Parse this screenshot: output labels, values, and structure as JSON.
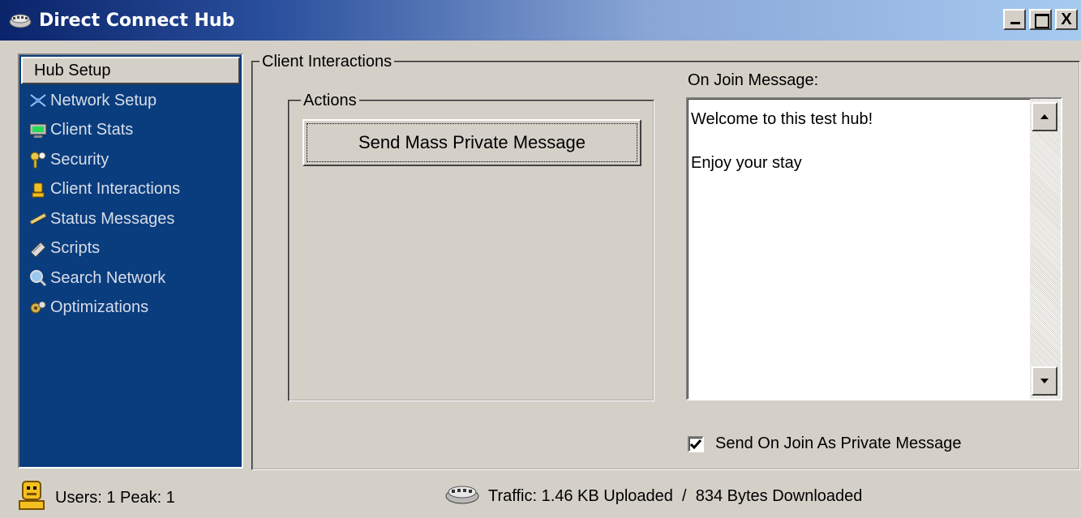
{
  "window": {
    "title": "Direct Connect Hub",
    "icon": "hub-icon",
    "buttons": {
      "minimize": "_",
      "maximize": "□",
      "close": "X"
    }
  },
  "sidebar": {
    "header": "Hub Setup",
    "items": [
      {
        "label": "Network Setup",
        "icon": "network-icon"
      },
      {
        "label": "Client Stats",
        "icon": "monitor-icon"
      },
      {
        "label": "Security",
        "icon": "keys-icon"
      },
      {
        "label": "Client Interactions",
        "icon": "user-icon"
      },
      {
        "label": "Status Messages",
        "icon": "messages-icon"
      },
      {
        "label": "Scripts",
        "icon": "script-icon"
      },
      {
        "label": "Search Network",
        "icon": "search-icon"
      },
      {
        "label": "Optimizations",
        "icon": "optimize-icon"
      }
    ]
  },
  "main": {
    "group_title": "Client Interactions",
    "actions": {
      "title": "Actions",
      "mass_pm_button": "Send Mass Private Message"
    },
    "on_join": {
      "label": "On Join Message:",
      "message": "Welcome to this test hub!\n\nEnjoy your stay",
      "send_as_pm_label": "Send On Join As Private Message",
      "send_as_pm_checked": true
    }
  },
  "status": {
    "users": "Users: 1 Peak: 1",
    "traffic": "Traffic: 1.46 KB Uploaded  /  834 Bytes Downloaded"
  },
  "colors": {
    "sidebar_bg": "#0a3d7e",
    "title_gradient_start": "#0a246a",
    "face": "#d4d0c8"
  }
}
